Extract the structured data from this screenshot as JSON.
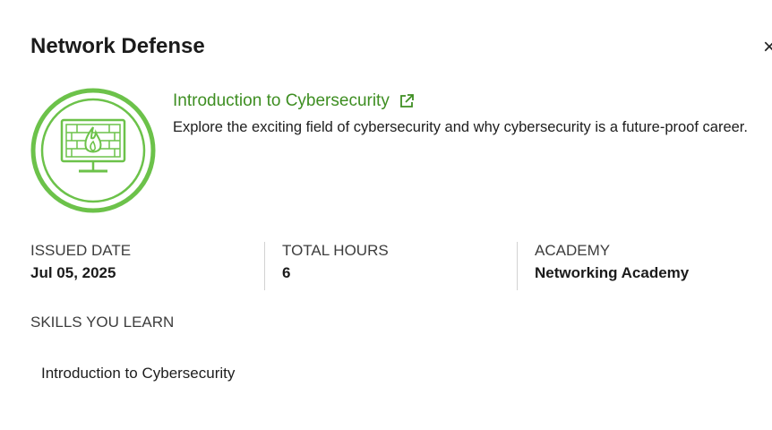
{
  "modal": {
    "title": "Network Defense",
    "close_symbol": "×"
  },
  "course": {
    "link_text": "Introduction to Cybersecurity",
    "link_icon": "external-link-icon",
    "badge_icon": "firewall-monitor-icon",
    "description": "Explore the exciting field of cybersecurity and why cybersecurity is a future-proof career."
  },
  "meta": {
    "issued_date_label": "ISSUED DATE",
    "issued_date_value": "Jul 05, 2025",
    "total_hours_label": "TOTAL HOURS",
    "total_hours_value": "6",
    "academy_label": "ACADEMY",
    "academy_value": "Networking Academy"
  },
  "skills": {
    "label": "SKILLS YOU LEARN",
    "items": [
      "Introduction to Cybersecurity"
    ]
  },
  "colors": {
    "accent_green": "#3e8e22",
    "badge_green": "#6cc24a"
  }
}
